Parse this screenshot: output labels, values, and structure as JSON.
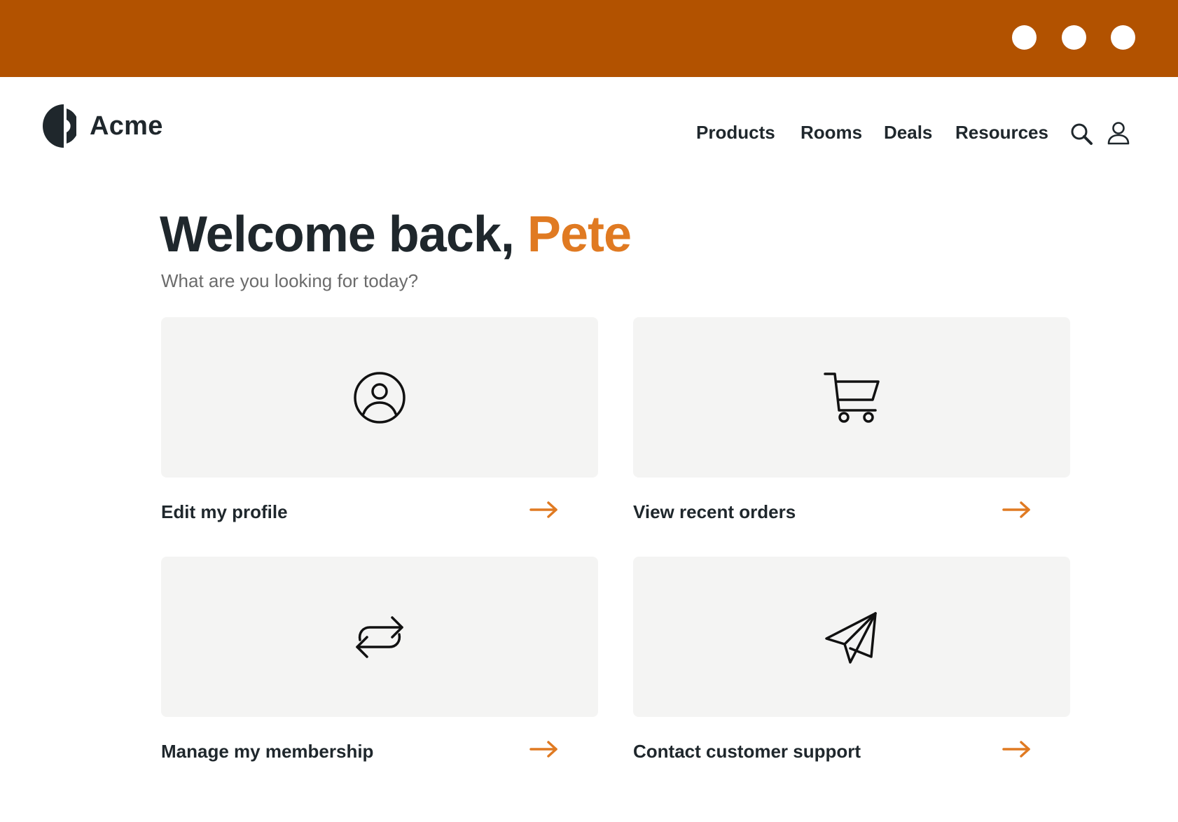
{
  "colors": {
    "topbar": "#b25200",
    "accent": "#e07a22",
    "text": "#1f272c",
    "muted": "#6b6b6b",
    "card_bg": "#f4f4f3"
  },
  "brand": {
    "name": "Acme",
    "logo_icon": "half-circle-logo-icon"
  },
  "nav": {
    "links": [
      "Products",
      "Rooms",
      "Deals",
      "Resources"
    ],
    "icons": [
      "search-icon",
      "user-icon"
    ]
  },
  "hero": {
    "greeting": "Welcome back,",
    "name": "Pete",
    "subtitle": "What are you looking for today?"
  },
  "cards": [
    {
      "label": "Edit my profile",
      "icon": "user-circle-icon"
    },
    {
      "label": "View recent orders",
      "icon": "shopping-cart-icon"
    },
    {
      "label": "Manage my membership",
      "icon": "repeat-icon"
    },
    {
      "label": "Contact customer support",
      "icon": "paper-plane-icon"
    }
  ]
}
